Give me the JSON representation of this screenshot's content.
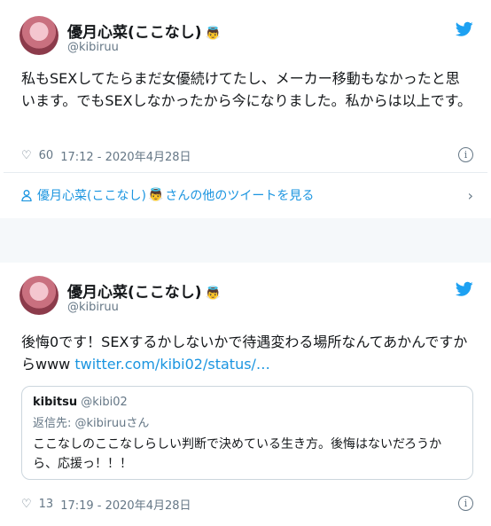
{
  "tweets": [
    {
      "name": "優月心菜(ここなし)",
      "emoji": "👼",
      "handle": "@kibiruu",
      "text": "私もSEXしてたらまだ女優続けてたし、メーカー移動もなかったと思います。でもSEXしなかったから今になりました。私からは以上です。",
      "likes": "60",
      "timestamp": "17:12 - 2020年4月28日"
    },
    {
      "name": "優月心菜(ここなし)",
      "emoji": "👼",
      "handle": "@kibiruu",
      "text": "後悔0です！SEXするかしないかで待遇変わる場所なんてあかんですからwww ",
      "link": "twitter.com/kibi02/status/…",
      "likes": "13",
      "timestamp": "17:19 - 2020年4月28日"
    }
  ],
  "more_link": {
    "prefix": "優月心菜(ここなし)",
    "emoji": "👼",
    "suffix": "さんの他のツイートを見る"
  },
  "quote": {
    "name": "kibitsu",
    "handle": "@kibi02",
    "reply": "返信先: @kibiruuさん",
    "text": "ここなしのここなしらしい判断で決めている生き方。後悔はないだろうから、応援っ！！！"
  },
  "colors": {
    "twitter_blue": "#1b95e0",
    "secondary_text": "#657786"
  },
  "icons": [
    "heart-icon",
    "info-icon",
    "twitter-bird-icon",
    "user-icon",
    "chevron-right-icon"
  ]
}
